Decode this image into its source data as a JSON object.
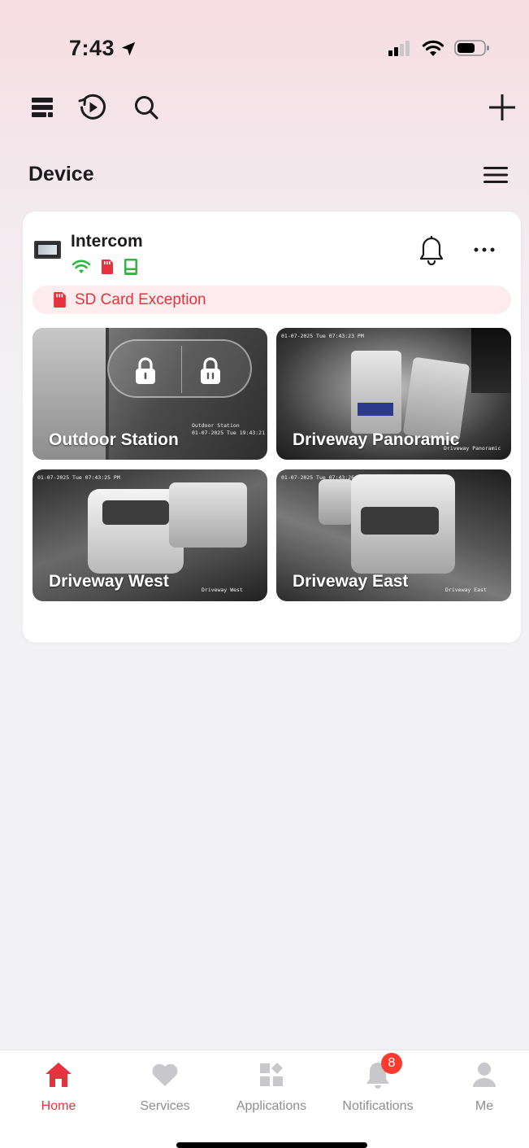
{
  "status": {
    "time": "7:43"
  },
  "toolbar": {
    "icons": [
      "view-list-icon",
      "playback-icon",
      "search-icon",
      "add-icon"
    ]
  },
  "section": {
    "title": "Device"
  },
  "device": {
    "name": "Intercom",
    "alert": "SD Card Exception",
    "cameras": [
      {
        "name": "Outdoor Station",
        "osd_name": "Outdoor Station",
        "osd_time": "01-07-2025 Tue 19:43:21"
      },
      {
        "name": "Driveway Panoramic",
        "osd_time": "01-07-2025 Tue 07:43:23 PM",
        "osd_name": "Driveway Panoramic"
      },
      {
        "name": "Driveway West",
        "osd_time": "01-07-2025 Tue 07:43:25 PM",
        "osd_name": "Driveway West"
      },
      {
        "name": "Driveway East",
        "osd_time": "01-07-2025 Tue 07:43:26 PM",
        "osd_name": "Driveway East"
      }
    ]
  },
  "tabs": [
    {
      "label": "Home",
      "active": true
    },
    {
      "label": "Services"
    },
    {
      "label": "Applications"
    },
    {
      "label": "Notifications",
      "badge": "8"
    },
    {
      "label": "Me"
    }
  ],
  "colors": {
    "accent": "#e5333d",
    "inactive": "#8e8e93",
    "wifi": "#2db842",
    "sd": "#e5333d",
    "status_ok": "#2db842"
  }
}
